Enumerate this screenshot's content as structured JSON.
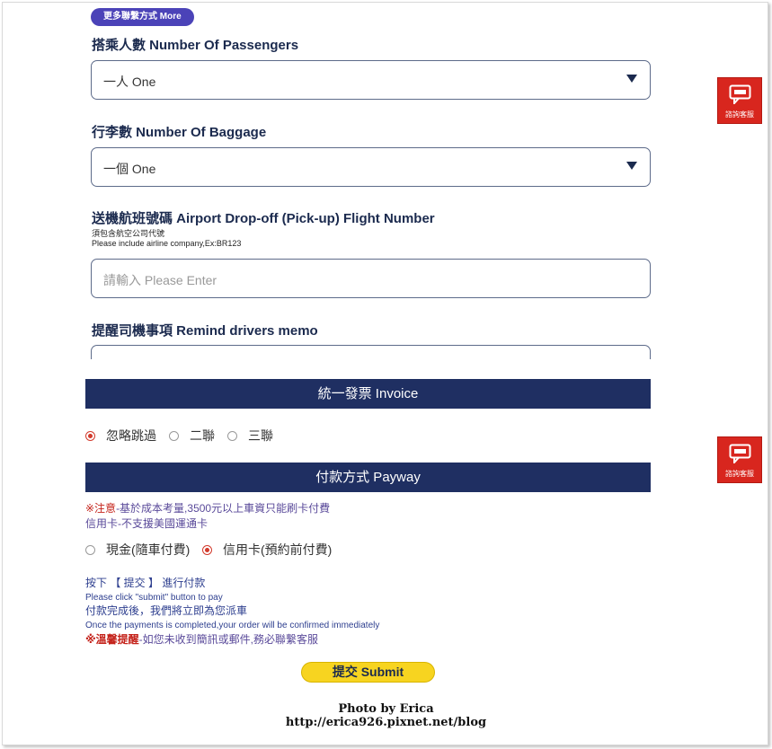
{
  "more_contact_label": "更多聯繫方式 More",
  "passengers": {
    "label": "搭乘人數 Number Of Passengers",
    "value": "一人 One"
  },
  "baggage": {
    "label": "行李數 Number Of Baggage",
    "value": "一個 One"
  },
  "flight": {
    "label": "送機航班號碼 Airport Drop-off (Pick-up) Flight Number",
    "hint_zh": "須包含航空公司代號",
    "hint_en": "Please include airline company,Ex:BR123",
    "placeholder": "請輸入 Please Enter"
  },
  "memo": {
    "label": "提醒司機事項 Remind drivers memo"
  },
  "invoice": {
    "title": "統一發票 Invoice",
    "options": [
      {
        "label": "忽略跳過",
        "selected": true
      },
      {
        "label": "二聯",
        "selected": false
      },
      {
        "label": "三聯",
        "selected": false
      }
    ]
  },
  "payway": {
    "title": "付款方式 Payway",
    "notice_prefix": "※注意",
    "notice_text": "-基於成本考量,3500元以上車資只能刷卡付費",
    "notice_line2": "信用卡-不支援美國運通卡",
    "options": [
      {
        "label": "現金(隨車付費)",
        "selected": false
      },
      {
        "label": "信用卡(預約前付費)",
        "selected": true
      }
    ]
  },
  "instructions": {
    "line1": "按下 【 提交 】 進行付款",
    "line2": "Please click \"submit\" button to pay",
    "line3": "付款完成後，我們將立即為您派車",
    "line4": "Once the payments is completed,your order will be confirmed immediately",
    "warn_prefix": "※溫馨提醒",
    "warn_text": "-如您未收到簡訊或郵件,務必聯繫客服"
  },
  "submit_label": "提交 Submit",
  "side_button_label": "諮詢客服",
  "watermark": {
    "line1": "Photo by Erica",
    "line2": "http://erica926.pixnet.net/blog"
  },
  "colors": {
    "navy_bar": "#1f2f62",
    "submit_yellow": "#f7d420",
    "side_red": "#d8261e",
    "radio_red": "#d23a2c"
  }
}
